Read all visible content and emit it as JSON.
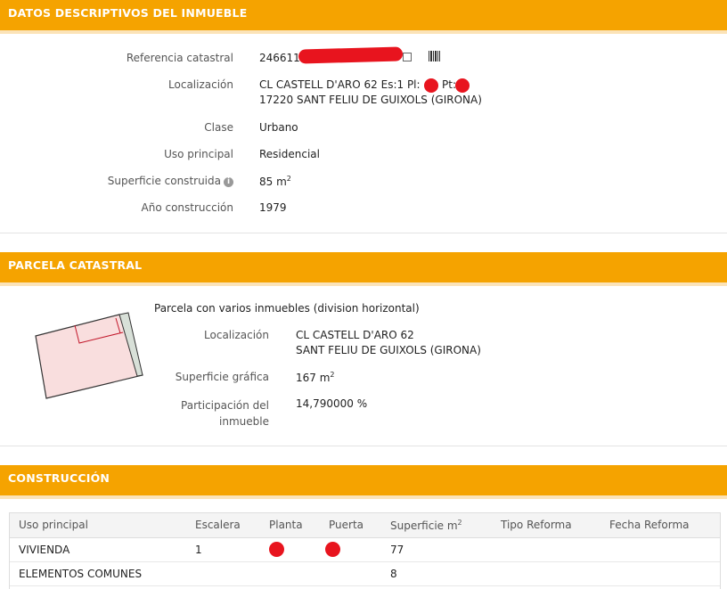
{
  "datos": {
    "header": "DATOS DESCRIPTIVOS DEL INMUEBLE",
    "ref_label": "Referencia catastral",
    "ref_value": "246611",
    "loc_label": "Localización",
    "loc_line1": "CL CASTELL D'ARO 62 Es:1 Pl:",
    "loc_pt": "Pt:",
    "loc_line2": "17220 SANT FELIU DE GUIXOLS (GIRONA)",
    "clase_label": "Clase",
    "clase_value": "Urbano",
    "uso_label": "Uso principal",
    "uso_value": "Residencial",
    "sup_label": "Superficie construida",
    "sup_value": "85 m",
    "sup_unit_exp": "2",
    "anio_label": "Año construcción",
    "anio_value": "1979"
  },
  "parcela": {
    "header": "PARCELA CATASTRAL",
    "title": "Parcela con varios inmuebles (division horizontal)",
    "loc_label": "Localización",
    "loc_line1": "CL CASTELL D'ARO 62",
    "loc_line2": "SANT FELIU DE GUIXOLS (GIRONA)",
    "supg_label": "Superficie gráfica",
    "supg_value": "167 m",
    "supg_exp": "2",
    "part_label_1": "Participación del",
    "part_label_2": "inmueble",
    "part_value": "14,790000 %"
  },
  "construccion": {
    "header": "CONSTRUCCIÓN",
    "columns": [
      "Uso principal",
      "Escalera",
      "Planta",
      "Puerta",
      "Superficie m",
      "Tipo Reforma",
      "Fecha Reforma"
    ],
    "sup_exp": "2",
    "rows": [
      {
        "uso": "VIVIENDA",
        "escalera": "1",
        "superficie": "77"
      },
      {
        "uso": "ELEMENTOS COMUNES",
        "escalera": "",
        "superficie": "8"
      }
    ]
  },
  "icons": {
    "copy": "copy-icon",
    "barcode": "barcode-icon",
    "info": "info-icon"
  },
  "colors": {
    "header_bg": "#f5a300",
    "redaction": "#e8141e",
    "parcel_fill": "#f9dede",
    "parcel_line": "#c2182b"
  }
}
